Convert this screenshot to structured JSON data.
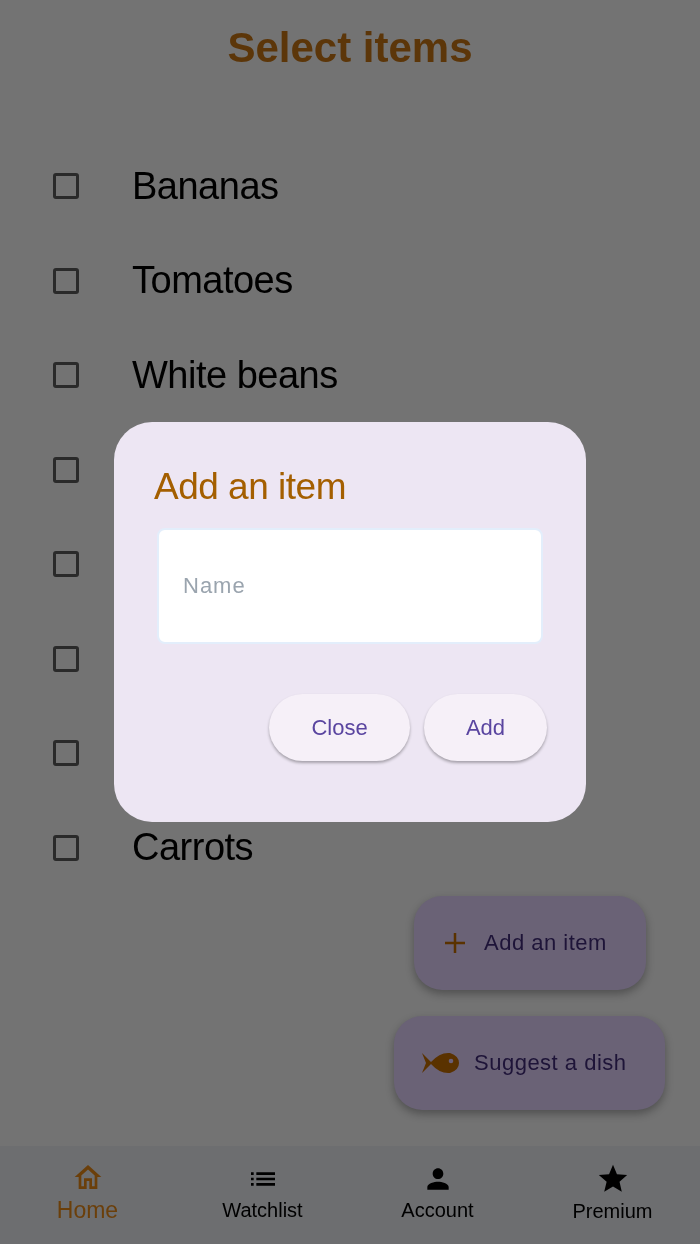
{
  "title": "Select items",
  "items": [
    {
      "label": "Bananas",
      "checked": false
    },
    {
      "label": "Tomatoes",
      "checked": false
    },
    {
      "label": "White beans",
      "checked": false
    },
    {
      "checked": false
    },
    {
      "checked": false
    },
    {
      "checked": false
    },
    {
      "checked": false
    },
    {
      "label": "Carrots",
      "checked": false
    }
  ],
  "dialog": {
    "title": "Add an item",
    "field": {
      "placeholder": "Name"
    },
    "buttons": [
      "Close",
      "Add"
    ]
  },
  "fabs": [
    {
      "kind": "add",
      "label": "Add an item"
    },
    {
      "kind": "fish",
      "label": "Suggest a dish"
    }
  ],
  "nav": [
    {
      "kind": "home",
      "label": "Home",
      "selected": true
    },
    {
      "kind": "list",
      "label": "Watchlist",
      "selected": false
    },
    {
      "kind": "person",
      "label": "Account",
      "selected": false
    },
    {
      "kind": "star",
      "label": "Premium",
      "selected": false
    }
  ]
}
